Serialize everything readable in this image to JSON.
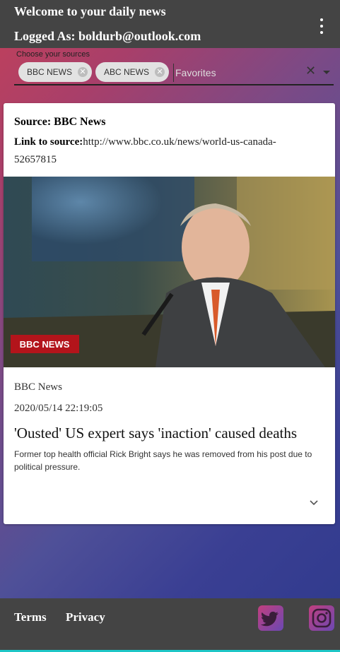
{
  "header": {
    "welcome": "Welcome to your daily news",
    "logged_as_prefix": "Logged As: ",
    "user_email": "boldurb@outlook.com",
    "menu_icon": "more-vert-icon"
  },
  "sources": {
    "label": "Choose your sources",
    "chips": [
      "BBC NEWS",
      "ABC NEWS"
    ],
    "placeholder": "Favorites",
    "clear_icon": "close-icon",
    "dropdown_icon": "caret-down-icon"
  },
  "article": {
    "source_label": "Source: BBC News",
    "link_label": "Link to source:",
    "link_url": "http://www.bbc.co.uk/news/world-us-canada-52657815",
    "image_logo": "BBC NEWS",
    "publisher": "BBC News",
    "date": "2020/05/14 22:19:05",
    "headline": "'Ousted' US expert says 'inaction' caused deaths",
    "summary": "Former top health official Rick Bright says he was removed from his post due to political pressure.",
    "expand_icon": "chevron-down-icon"
  },
  "footer": {
    "terms": "Terms",
    "privacy": "Privacy",
    "social": [
      "twitter-icon",
      "instagram-icon"
    ]
  },
  "colors": {
    "bar": "#444444",
    "accent": "#1ec6c6",
    "bg_start": "#c2415a",
    "bg_end": "#2f3a8c"
  }
}
